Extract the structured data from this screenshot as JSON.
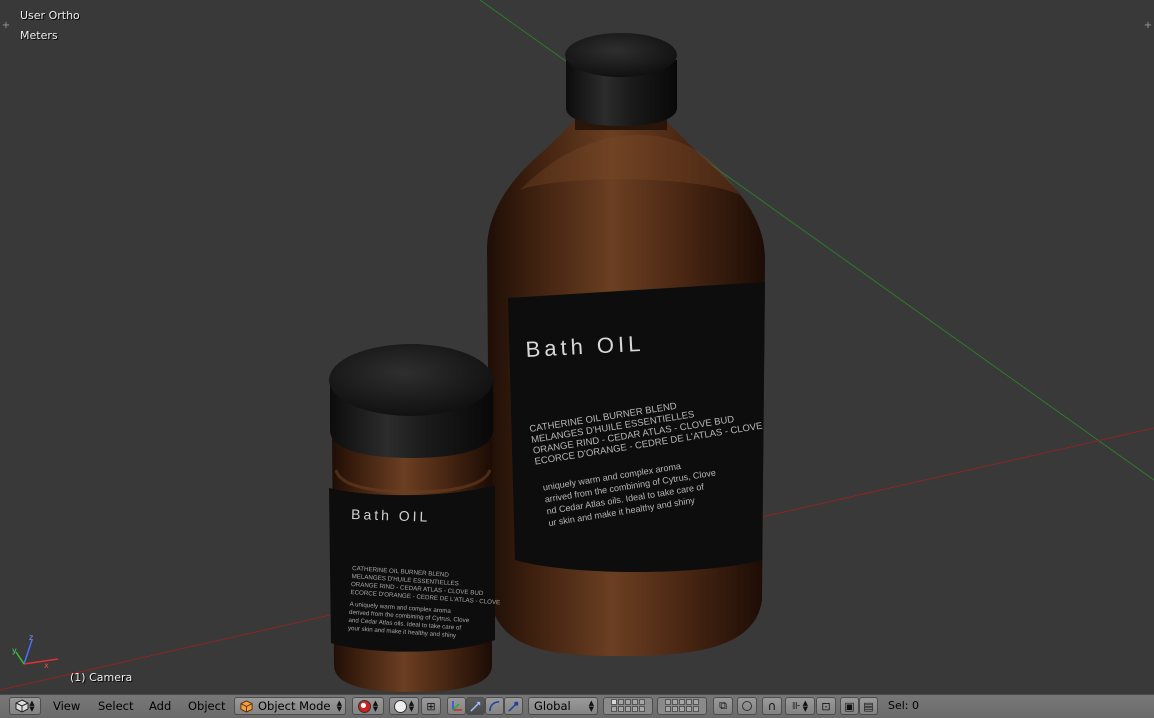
{
  "viewport": {
    "view_name": "User Ortho",
    "units": "Meters",
    "active_object": "(1) Camera",
    "plus_left": "+",
    "plus_right": "+",
    "background_color": "#393939",
    "grid_line_x_color": "#8a2b2b",
    "grid_line_y_color": "#2e7d2e"
  },
  "scene": {
    "large_bottle": {
      "label_title": "Bath OIL",
      "label_lines": [
        "CATHERINE OIL BURNER BLEND",
        "MELANGES D'HUILE ESSENTIELLES",
        "ORANGE RIND - CEDAR ATLAS - CLOVE BUD",
        "ECORCE D'ORANGE - CEDRE DE L'ATLAS - CLOVE"
      ],
      "label_desc": [
        "uniquely warm and complex aroma",
        "arrived from the combining of Cytrus, Clove",
        "nd Cedar Atlas oils. Ideal to take care of",
        "ur skin and make it healthy and shiny"
      ]
    },
    "small_jar": {
      "label_title": "Bath OIL",
      "label_lines": [
        "CATHERINE OIL BURNER BLEND",
        "MELANGES D'HUILE ESSENTIELLES",
        "ORANGE RIND - CEDAR ATLAS - CLOVE BUD",
        "ECORCE D'ORANGE - CEDRE DE L'ATLAS - CLOVE"
      ],
      "label_desc": [
        "A uniquely warm and complex aroma",
        "derived from the combining of Cytrus, Clove",
        "and Cedar Atlas oils. Ideal to take care of",
        "your skin and make it healthy and shiny"
      ]
    },
    "axis_gizmo": {
      "x": "x",
      "y": "y",
      "z": "z"
    }
  },
  "header": {
    "editor_type_icon": "cube-icon",
    "menus": [
      "View",
      "Select",
      "Add",
      "Object"
    ],
    "mode": "Object Mode",
    "orientation": "Global",
    "selected": "Sel: 0"
  }
}
